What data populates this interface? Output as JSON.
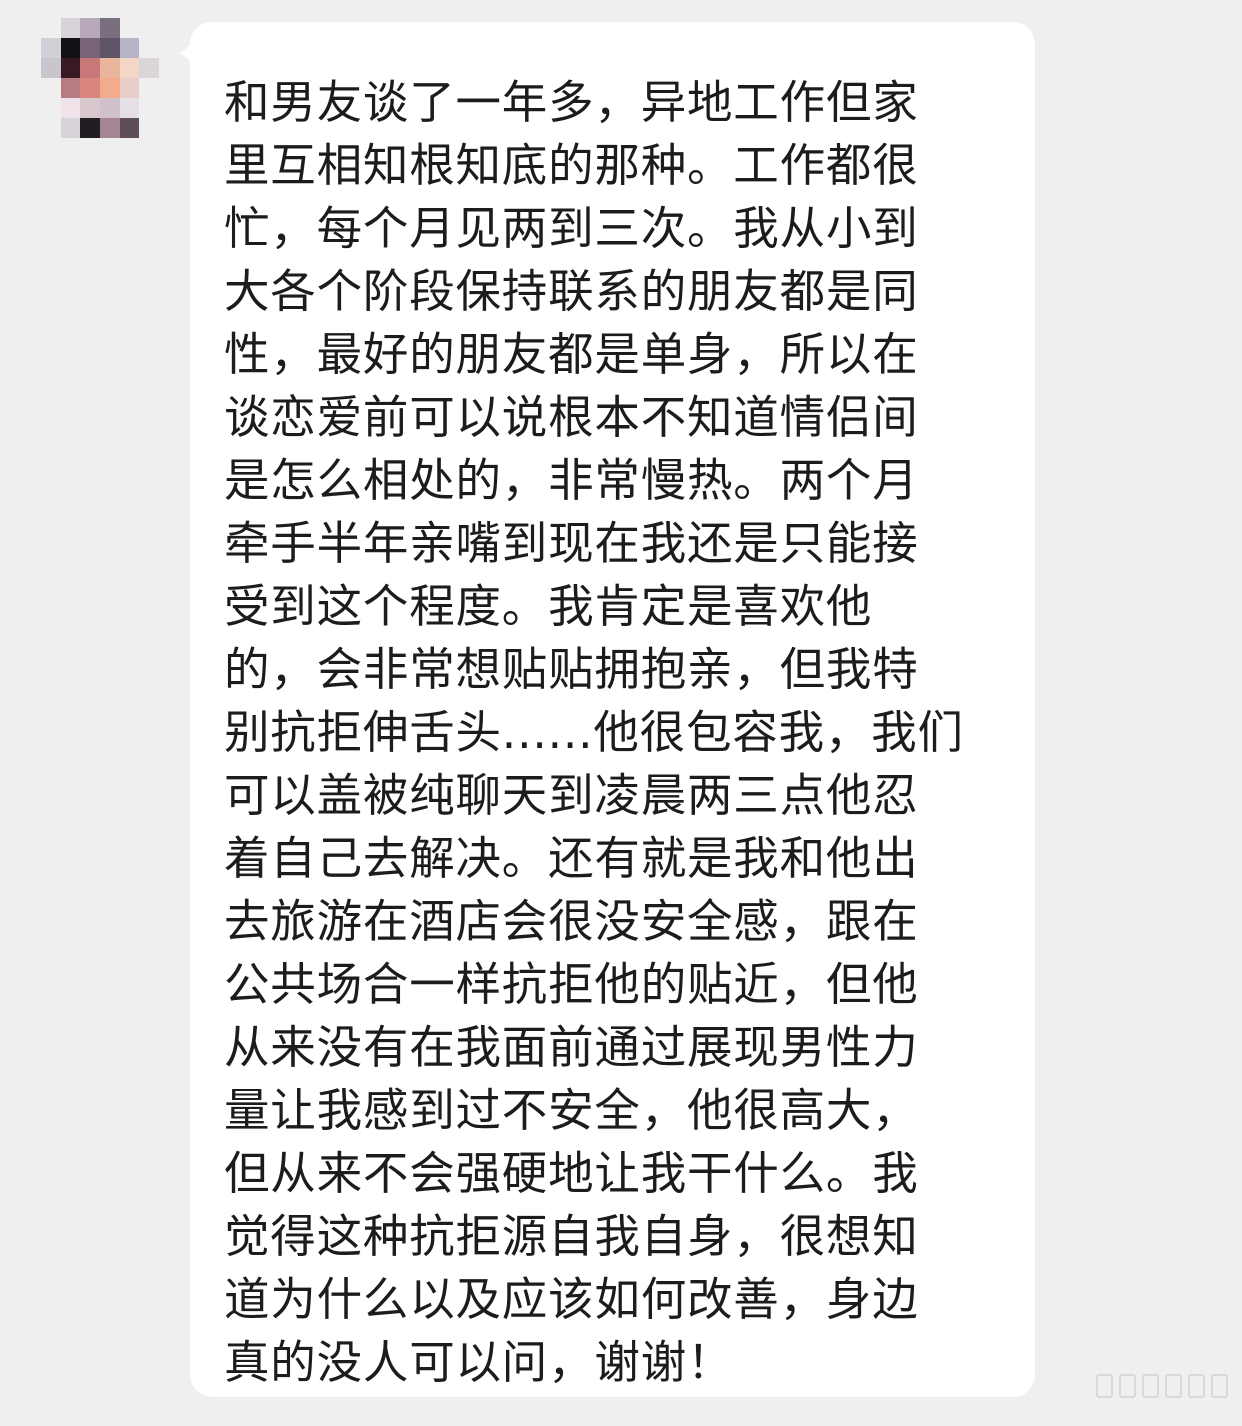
{
  "chat": {
    "avatar_icon": "pixelated-avatar-icon",
    "message_lines": [
      "和男友谈了一年多，异地工作但家",
      "里互相知根知底的那种。工作都很",
      "忙，每个月见两到三次。我从小到",
      "大各个阶段保持联系的朋友都是同",
      "性，最好的朋友都是单身，所以在",
      "谈恋爱前可以说根本不知道情侣间",
      "是怎么相处的，非常慢热。两个月",
      "牵手半年亲嘴到现在我还是只能接",
      "受到这个程度。我肯定是喜欢他",
      "的，会非常想贴贴拥抱亲，但我特",
      "别抗拒伸舌头......他很包容我，我们",
      "可以盖被纯聊天到凌晨两三点他忍",
      "着自己去解决。还有就是我和他出",
      "去旅游在酒店会很没安全感，跟在",
      "公共场合一样抗拒他的贴近，但他",
      "从来没有在我面前通过展现男性力",
      "量让我感到过不安全，他很高大，",
      "但从来不会强硬地让我干什么。我",
      "觉得这种抗拒源自我自身，很想知",
      "道为什么以及应该如何改善，身边",
      "真的没人可以问，谢谢！"
    ]
  },
  "colors": {
    "background": "#efefef",
    "bubble": "#ffffff",
    "text": "#1c1c1c"
  }
}
